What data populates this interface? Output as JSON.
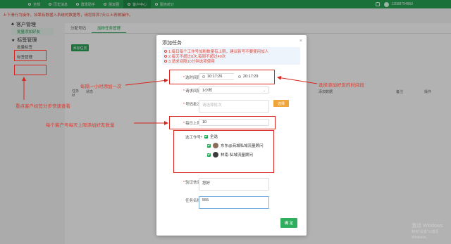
{
  "topbar": {
    "items": [
      "全部",
      "历史消息",
      "群发助手",
      "朋友圈",
      "客户中心",
      "服务统计"
    ],
    "active_index": 4,
    "user": "13588794889"
  },
  "notice": "上下滑行为操作，如果有数据入系统的数据等，请您将其7天以上再做操作。",
  "sidebar": {
    "group1": "客户管理",
    "group1_items": [
      "批量添加好友"
    ],
    "group2": "标签管理",
    "group2_items": [
      "批量标签",
      "标签管理"
    ]
  },
  "content": {
    "tabs": [
      "分配号码",
      "加粉任务管理"
    ],
    "active_tab": 1,
    "add_button": "添加任务",
    "table_headers": [
      "任务 Id",
      "状态",
      "添加数据",
      "备注",
      "操作"
    ]
  },
  "modal": {
    "title": "添加任务",
    "tips": [
      "1.每日每个工作号加粉数量有上限，建议新号不要使用加人",
      "2.每天不超过8次,每周不超过40次",
      "3.请求间隔10分钟选项使用"
    ],
    "time_label": "选时间段",
    "time_start": "10:17:26",
    "time_to": "至",
    "time_end": "20:17:29",
    "interval_label": "请求间隔",
    "interval_value": "1小时",
    "batch_label": "号码批次",
    "batch_placeholder": "请选择批次",
    "select_button": "选择",
    "daily_label": "每日上限",
    "daily_value": "10",
    "worker_label": "选工作号",
    "all_label": "全选",
    "workers": [
      "东东@商城私域流量顾问",
      "林南·私域流量顾问"
    ],
    "verify_label": "验证信息",
    "verify_value": "您好",
    "name_label": "任务名称",
    "name_value": "555",
    "confirm_button": "确 定"
  },
  "annotations": {
    "interval_note": "每隔一小时添加一次",
    "time_note": "选择添加好友的时间段",
    "tag_note": "重点客户标签分步快速查看",
    "daily_note": "每个客户号每天上限添加好友数量"
  },
  "colors": {
    "brand_green": "#26a353",
    "annotation_red": "#d8261f",
    "button_orange": "#f0a53a"
  },
  "watermark": {
    "line1": "激活 Windows",
    "line2": "转到\"设置\"以激活 Windows。"
  }
}
